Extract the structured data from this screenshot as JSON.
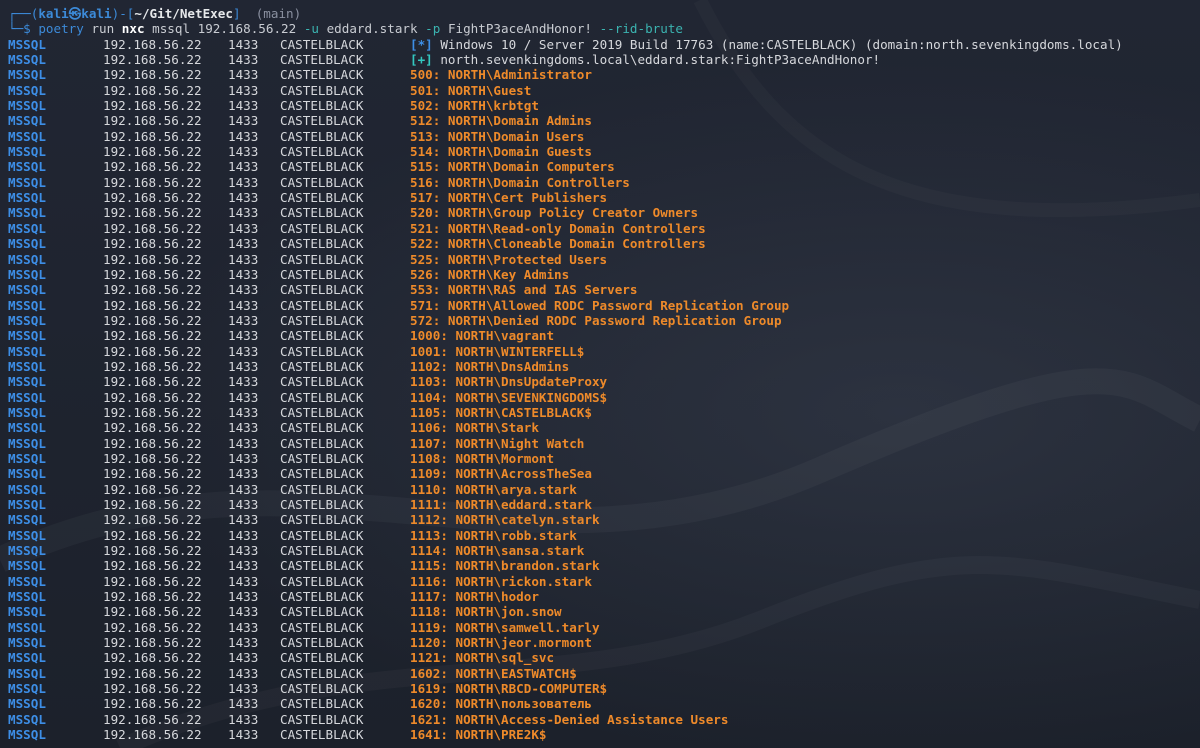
{
  "prompt": {
    "corner_top": "┌──(",
    "user_host": "kali㉿kali",
    "mid": ")-[",
    "path": "~/Git/NetExec",
    "end": "]",
    "branch": "(main)",
    "corner_bottom": "└─$",
    "cmd_poetry": "poetry",
    "cmd_run": "run",
    "cmd_nxc": "nxc",
    "cmd_proto": "mssql",
    "cmd_target": "192.168.56.22",
    "flag_u": "-u",
    "user": "eddard.stark",
    "flag_p": "-p",
    "password": "FightP3aceAndHonor!",
    "flag_rid": "--rid-brute"
  },
  "info_rows": [
    {
      "protocol": "MSSQL",
      "ip": "192.168.56.22",
      "port": "1433",
      "host": "CASTELBLACK",
      "tag": "[*]",
      "text": "Windows 10 / Server 2019 Build 17763 (name:CASTELBLACK) (domain:north.sevenkingdoms.local)"
    },
    {
      "protocol": "MSSQL",
      "ip": "192.168.56.22",
      "port": "1433",
      "host": "CASTELBLACK",
      "tag": "[+]",
      "text": "north.sevenkingdoms.local\\eddard.stark:FightP3aceAndHonor!"
    }
  ],
  "rows": [
    {
      "protocol": "MSSQL",
      "ip": "192.168.56.22",
      "port": "1433",
      "host": "CASTELBLACK",
      "text": "500: NORTH\\Administrator"
    },
    {
      "protocol": "MSSQL",
      "ip": "192.168.56.22",
      "port": "1433",
      "host": "CASTELBLACK",
      "text": "501: NORTH\\Guest"
    },
    {
      "protocol": "MSSQL",
      "ip": "192.168.56.22",
      "port": "1433",
      "host": "CASTELBLACK",
      "text": "502: NORTH\\krbtgt"
    },
    {
      "protocol": "MSSQL",
      "ip": "192.168.56.22",
      "port": "1433",
      "host": "CASTELBLACK",
      "text": "512: NORTH\\Domain Admins"
    },
    {
      "protocol": "MSSQL",
      "ip": "192.168.56.22",
      "port": "1433",
      "host": "CASTELBLACK",
      "text": "513: NORTH\\Domain Users"
    },
    {
      "protocol": "MSSQL",
      "ip": "192.168.56.22",
      "port": "1433",
      "host": "CASTELBLACK",
      "text": "514: NORTH\\Domain Guests"
    },
    {
      "protocol": "MSSQL",
      "ip": "192.168.56.22",
      "port": "1433",
      "host": "CASTELBLACK",
      "text": "515: NORTH\\Domain Computers"
    },
    {
      "protocol": "MSSQL",
      "ip": "192.168.56.22",
      "port": "1433",
      "host": "CASTELBLACK",
      "text": "516: NORTH\\Domain Controllers"
    },
    {
      "protocol": "MSSQL",
      "ip": "192.168.56.22",
      "port": "1433",
      "host": "CASTELBLACK",
      "text": "517: NORTH\\Cert Publishers"
    },
    {
      "protocol": "MSSQL",
      "ip": "192.168.56.22",
      "port": "1433",
      "host": "CASTELBLACK",
      "text": "520: NORTH\\Group Policy Creator Owners"
    },
    {
      "protocol": "MSSQL",
      "ip": "192.168.56.22",
      "port": "1433",
      "host": "CASTELBLACK",
      "text": "521: NORTH\\Read-only Domain Controllers"
    },
    {
      "protocol": "MSSQL",
      "ip": "192.168.56.22",
      "port": "1433",
      "host": "CASTELBLACK",
      "text": "522: NORTH\\Cloneable Domain Controllers"
    },
    {
      "protocol": "MSSQL",
      "ip": "192.168.56.22",
      "port": "1433",
      "host": "CASTELBLACK",
      "text": "525: NORTH\\Protected Users"
    },
    {
      "protocol": "MSSQL",
      "ip": "192.168.56.22",
      "port": "1433",
      "host": "CASTELBLACK",
      "text": "526: NORTH\\Key Admins"
    },
    {
      "protocol": "MSSQL",
      "ip": "192.168.56.22",
      "port": "1433",
      "host": "CASTELBLACK",
      "text": "553: NORTH\\RAS and IAS Servers"
    },
    {
      "protocol": "MSSQL",
      "ip": "192.168.56.22",
      "port": "1433",
      "host": "CASTELBLACK",
      "text": "571: NORTH\\Allowed RODC Password Replication Group"
    },
    {
      "protocol": "MSSQL",
      "ip": "192.168.56.22",
      "port": "1433",
      "host": "CASTELBLACK",
      "text": "572: NORTH\\Denied RODC Password Replication Group"
    },
    {
      "protocol": "MSSQL",
      "ip": "192.168.56.22",
      "port": "1433",
      "host": "CASTELBLACK",
      "text": "1000: NORTH\\vagrant"
    },
    {
      "protocol": "MSSQL",
      "ip": "192.168.56.22",
      "port": "1433",
      "host": "CASTELBLACK",
      "text": "1001: NORTH\\WINTERFELL$"
    },
    {
      "protocol": "MSSQL",
      "ip": "192.168.56.22",
      "port": "1433",
      "host": "CASTELBLACK",
      "text": "1102: NORTH\\DnsAdmins"
    },
    {
      "protocol": "MSSQL",
      "ip": "192.168.56.22",
      "port": "1433",
      "host": "CASTELBLACK",
      "text": "1103: NORTH\\DnsUpdateProxy"
    },
    {
      "protocol": "MSSQL",
      "ip": "192.168.56.22",
      "port": "1433",
      "host": "CASTELBLACK",
      "text": "1104: NORTH\\SEVENKINGDOMS$"
    },
    {
      "protocol": "MSSQL",
      "ip": "192.168.56.22",
      "port": "1433",
      "host": "CASTELBLACK",
      "text": "1105: NORTH\\CASTELBLACK$"
    },
    {
      "protocol": "MSSQL",
      "ip": "192.168.56.22",
      "port": "1433",
      "host": "CASTELBLACK",
      "text": "1106: NORTH\\Stark"
    },
    {
      "protocol": "MSSQL",
      "ip": "192.168.56.22",
      "port": "1433",
      "host": "CASTELBLACK",
      "text": "1107: NORTH\\Night Watch"
    },
    {
      "protocol": "MSSQL",
      "ip": "192.168.56.22",
      "port": "1433",
      "host": "CASTELBLACK",
      "text": "1108: NORTH\\Mormont"
    },
    {
      "protocol": "MSSQL",
      "ip": "192.168.56.22",
      "port": "1433",
      "host": "CASTELBLACK",
      "text": "1109: NORTH\\AcrossTheSea"
    },
    {
      "protocol": "MSSQL",
      "ip": "192.168.56.22",
      "port": "1433",
      "host": "CASTELBLACK",
      "text": "1110: NORTH\\arya.stark"
    },
    {
      "protocol": "MSSQL",
      "ip": "192.168.56.22",
      "port": "1433",
      "host": "CASTELBLACK",
      "text": "1111: NORTH\\eddard.stark"
    },
    {
      "protocol": "MSSQL",
      "ip": "192.168.56.22",
      "port": "1433",
      "host": "CASTELBLACK",
      "text": "1112: NORTH\\catelyn.stark"
    },
    {
      "protocol": "MSSQL",
      "ip": "192.168.56.22",
      "port": "1433",
      "host": "CASTELBLACK",
      "text": "1113: NORTH\\robb.stark"
    },
    {
      "protocol": "MSSQL",
      "ip": "192.168.56.22",
      "port": "1433",
      "host": "CASTELBLACK",
      "text": "1114: NORTH\\sansa.stark"
    },
    {
      "protocol": "MSSQL",
      "ip": "192.168.56.22",
      "port": "1433",
      "host": "CASTELBLACK",
      "text": "1115: NORTH\\brandon.stark"
    },
    {
      "protocol": "MSSQL",
      "ip": "192.168.56.22",
      "port": "1433",
      "host": "CASTELBLACK",
      "text": "1116: NORTH\\rickon.stark"
    },
    {
      "protocol": "MSSQL",
      "ip": "192.168.56.22",
      "port": "1433",
      "host": "CASTELBLACK",
      "text": "1117: NORTH\\hodor"
    },
    {
      "protocol": "MSSQL",
      "ip": "192.168.56.22",
      "port": "1433",
      "host": "CASTELBLACK",
      "text": "1118: NORTH\\jon.snow"
    },
    {
      "protocol": "MSSQL",
      "ip": "192.168.56.22",
      "port": "1433",
      "host": "CASTELBLACK",
      "text": "1119: NORTH\\samwell.tarly"
    },
    {
      "protocol": "MSSQL",
      "ip": "192.168.56.22",
      "port": "1433",
      "host": "CASTELBLACK",
      "text": "1120: NORTH\\jeor.mormont"
    },
    {
      "protocol": "MSSQL",
      "ip": "192.168.56.22",
      "port": "1433",
      "host": "CASTELBLACK",
      "text": "1121: NORTH\\sql_svc"
    },
    {
      "protocol": "MSSQL",
      "ip": "192.168.56.22",
      "port": "1433",
      "host": "CASTELBLACK",
      "text": "1602: NORTH\\EASTWATCH$"
    },
    {
      "protocol": "MSSQL",
      "ip": "192.168.56.22",
      "port": "1433",
      "host": "CASTELBLACK",
      "text": "1619: NORTH\\RBCD-COMPUTER$"
    },
    {
      "protocol": "MSSQL",
      "ip": "192.168.56.22",
      "port": "1433",
      "host": "CASTELBLACK",
      "text": "1620: NORTH\\пользователь"
    },
    {
      "protocol": "MSSQL",
      "ip": "192.168.56.22",
      "port": "1433",
      "host": "CASTELBLACK",
      "text": "1621: NORTH\\Access-Denied Assistance Users"
    },
    {
      "protocol": "MSSQL",
      "ip": "192.168.56.22",
      "port": "1433",
      "host": "CASTELBLACK",
      "text": "1641: NORTH\\PRE2K$"
    }
  ],
  "colors": {
    "background": "#1f2430",
    "protocol": "#3d8ee6",
    "rid_text": "#ee8a2a",
    "info_tag": "#3d8ee6",
    "success_tag": "#33c8c0",
    "flag": "#3bb3b0"
  }
}
